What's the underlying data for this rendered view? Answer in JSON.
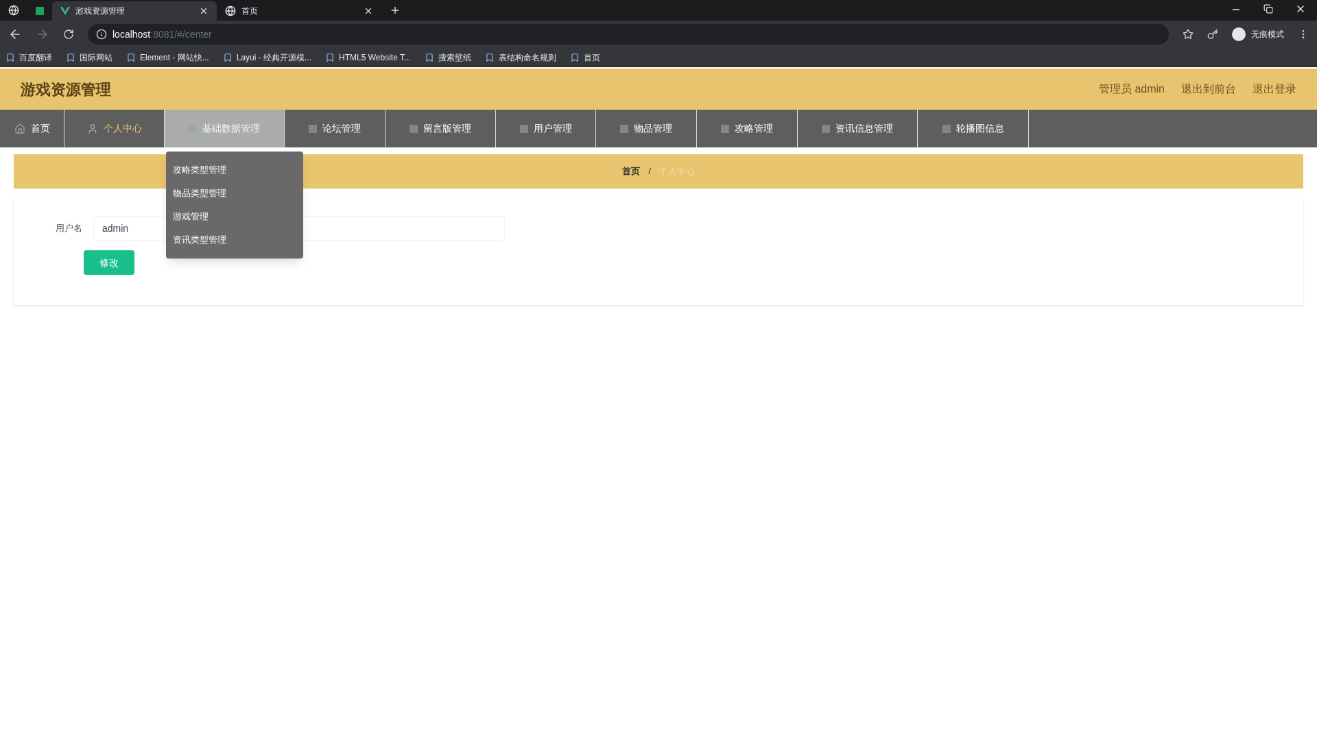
{
  "browser": {
    "tabs": [
      {
        "title": "游戏资源管理",
        "selected": true
      },
      {
        "title": "首页",
        "selected": false
      }
    ],
    "address": {
      "host": "localhost",
      "rest": ":8081/#/center"
    },
    "profile": "无痕模式",
    "bookmarks": [
      "百度翻译",
      "国际网站",
      "Element - 网站快...",
      "Layui - 经典开源模...",
      "HTML5 Website T...",
      "搜索壁纸",
      "表结构命名规则",
      "首页"
    ]
  },
  "header": {
    "title": "游戏资源管理",
    "links": [
      "管理员 admin",
      "退出到前台",
      "退出登录"
    ]
  },
  "nav": [
    {
      "label": "首页",
      "selected": false
    },
    {
      "label": "个人中心",
      "selected": false
    },
    {
      "label": "基础数据管理",
      "selected": true
    },
    {
      "label": "论坛管理",
      "selected": false
    },
    {
      "label": "留言版管理",
      "selected": false
    },
    {
      "label": "用户管理",
      "selected": false
    },
    {
      "label": "物品管理",
      "selected": false
    },
    {
      "label": "攻略管理",
      "selected": false
    },
    {
      "label": "资讯信息管理",
      "selected": false
    },
    {
      "label": "轮播图信息",
      "selected": false
    }
  ],
  "dropdown": [
    "攻略类型管理",
    "物品类型管理",
    "游戏管理",
    "资讯类型管理"
  ],
  "breadcrumb": [
    "首页",
    "个人中心"
  ],
  "breadcrumb_separator": "/",
  "form": {
    "label": "用户名",
    "value": "admin",
    "button": "修改"
  }
}
